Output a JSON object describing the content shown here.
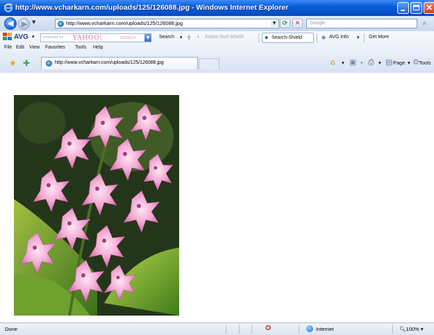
{
  "window": {
    "title": "http://www.vcharkarn.com/uploads/125/126088.jpg - Windows Internet Explorer"
  },
  "address_bar": {
    "url": "http://www.vcharkarn.com/uploads/125/126088.jpg",
    "search_placeholder": "Google"
  },
  "avg_toolbar": {
    "brand": "AVG",
    "yahoo_prefix": "powered by",
    "yahoo_brand": "YAHOO!",
    "yahoo_search": "SEARCH",
    "search_label": "Search",
    "active_surf_shield": "Active Surf-Shield",
    "search_shield": "Search-Shield",
    "avg_info": "AVG Info",
    "get_more": "Get More"
  },
  "menu": {
    "items": [
      "File",
      "Edit",
      "View",
      "Favorites",
      "Tools",
      "Help"
    ]
  },
  "tab": {
    "label": "http://www.vcharkarn.com/uploads/125/126088.jpg"
  },
  "commandbar": {
    "page": "Page",
    "tools": "Tools"
  },
  "content": {
    "image_subject": "pink orchid flowers"
  },
  "status": {
    "text": "Done",
    "zone": "Internet",
    "zoom": "100%"
  },
  "colors": {
    "titlebar": "#0a5fd8",
    "accent": "#2a7fd0"
  }
}
